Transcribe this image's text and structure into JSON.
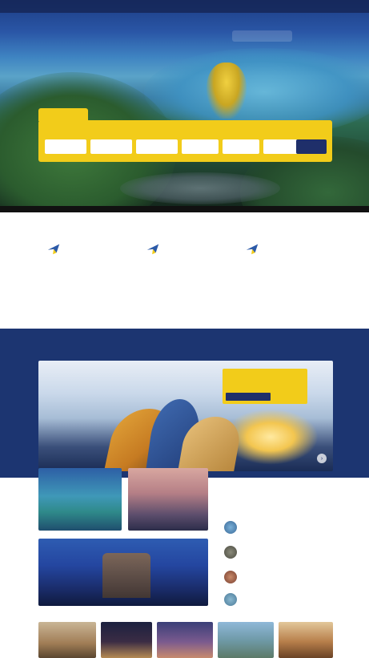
{
  "topbar": {
    "items": [
      "",
      "",
      "",
      "",
      ""
    ]
  },
  "brand": {
    "name": ""
  },
  "nav": {
    "items": [
      "",
      "",
      "",
      "",
      ""
    ],
    "cta": ""
  },
  "hero": {
    "title": "",
    "subtitle": ""
  },
  "booking": {
    "tab": "",
    "label": "",
    "fields": [
      "",
      "",
      "",
      "",
      "",
      ""
    ],
    "search_label": ""
  },
  "hero_links": [
    "",
    "",
    "",
    ""
  ],
  "features": [
    {
      "title": "",
      "desc": "",
      "icon": "plane-icon"
    },
    {
      "title": "",
      "desc": "",
      "icon": "plane-icon"
    },
    {
      "title": "",
      "desc": "",
      "icon": "plane-icon"
    }
  ],
  "destinations": {
    "title": "",
    "promo": {
      "line1": "",
      "line2": "",
      "button": ""
    },
    "tiles": [
      "",
      "",
      ""
    ]
  },
  "deals": {
    "title": "",
    "subtitle": "",
    "items": [
      {
        "name": "",
        "price": ""
      },
      {
        "name": "",
        "price": ""
      },
      {
        "name": "",
        "price": ""
      },
      {
        "name": "",
        "price": ""
      }
    ]
  },
  "colors": {
    "brand_blue": "#1c3571",
    "accent_yellow": "#f2cc1a",
    "navy_text": "#1f2f6a"
  }
}
